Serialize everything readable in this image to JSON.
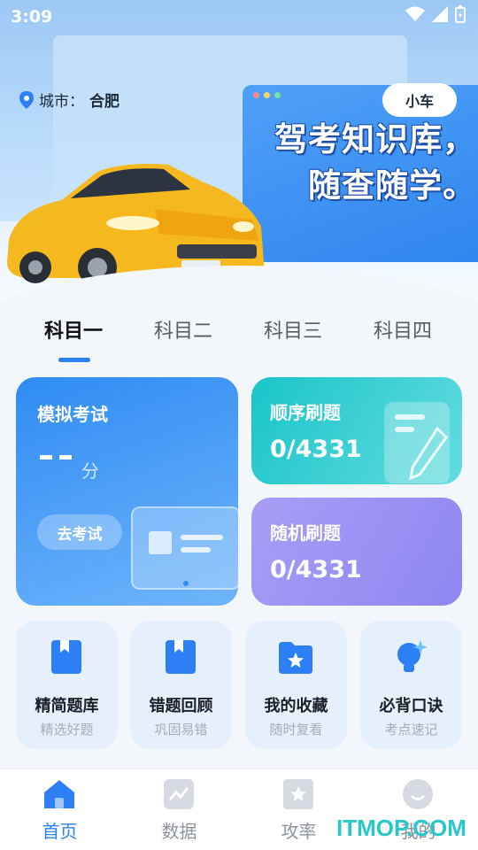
{
  "status_bar": {
    "time": "3:09"
  },
  "header": {
    "city_label": "城市：",
    "city_value": "合肥",
    "vehicle_type": "小车",
    "slogan_line1": "驾考知识库，",
    "slogan_line2": "随查随学。"
  },
  "subject_tabs": [
    {
      "label": "科目一",
      "active": true
    },
    {
      "label": "科目二",
      "active": false
    },
    {
      "label": "科目三",
      "active": false
    },
    {
      "label": "科目四",
      "active": false
    }
  ],
  "mock_exam": {
    "title": "模拟考试",
    "score_unit": "分",
    "button_label": "去考试"
  },
  "sequential": {
    "title": "顺序刷题",
    "progress": "0/4331"
  },
  "random": {
    "title": "随机刷题",
    "progress": "0/4331"
  },
  "tools": [
    {
      "label": "精简题库",
      "sub": "精选好题",
      "icon": "book-icon"
    },
    {
      "label": "错题回顾",
      "sub": "巩固易错",
      "icon": "bookmark-book-icon"
    },
    {
      "label": "我的收藏",
      "sub": "随时复看",
      "icon": "star-folder-icon"
    },
    {
      "label": "必背口诀",
      "sub": "考点速记",
      "icon": "lightbulb-icon"
    }
  ],
  "bottom_nav": [
    {
      "label": "首页",
      "icon": "home-icon",
      "active": true
    },
    {
      "label": "数据",
      "icon": "chart-icon",
      "active": false
    },
    {
      "label": "攻率",
      "icon": "badge-icon",
      "active": false
    },
    {
      "label": "我的",
      "icon": "profile-icon",
      "active": false
    }
  ],
  "watermark": "ITMOP.COM",
  "colors": {
    "accent": "#2d7ff5",
    "teal": "#19c5c9",
    "purple": "#9a92f4"
  }
}
